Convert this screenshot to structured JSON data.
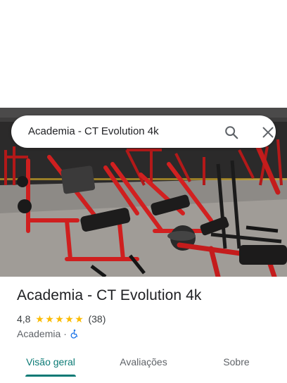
{
  "search": {
    "query": "Academia - CT Evolution 4k"
  },
  "icons": {
    "search": "search-icon",
    "close": "close-icon",
    "wheelchair": "wheelchair-icon",
    "star": "star-icon"
  },
  "place": {
    "title": "Academia - CT Evolution 4k",
    "rating": "4,8",
    "stars": 4.8,
    "star_glyph": "★",
    "review_count": "(38)",
    "category": "Academia",
    "separator": "·"
  },
  "tabs": [
    {
      "label": "Visão geral",
      "active": true
    },
    {
      "label": "Avaliações",
      "active": false
    },
    {
      "label": "Sobre",
      "active": false
    }
  ],
  "colors": {
    "accent": "#0b7a75",
    "star": "#fbbc04",
    "equipment_red": "#c81c1c",
    "accessibility_blue": "#1a73e8"
  }
}
